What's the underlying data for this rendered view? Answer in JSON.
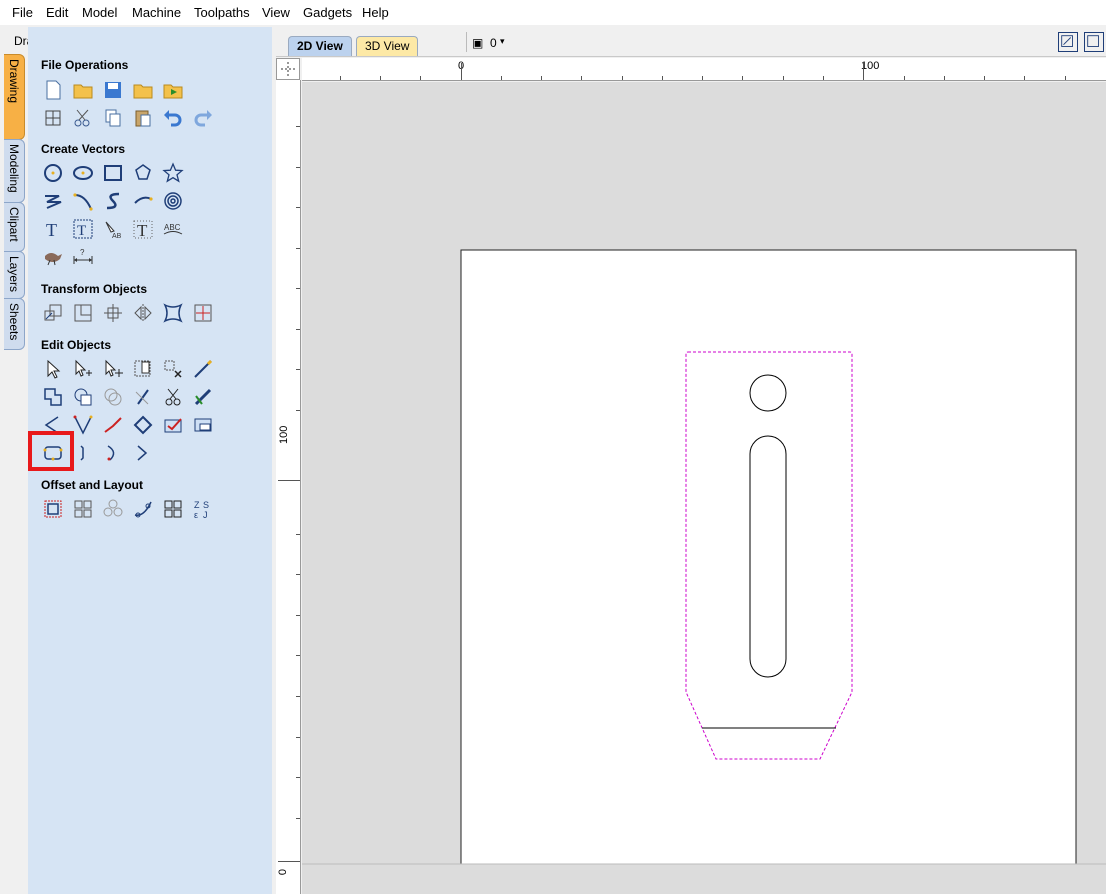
{
  "menu": [
    "File",
    "Edit",
    "Model",
    "Machine",
    "Toolpaths",
    "View",
    "Gadgets",
    "Help"
  ],
  "left_pane": {
    "title": "Drawing",
    "help": "?",
    "pin": "⊞",
    "vertical_tabs": [
      "Drawing",
      "Modeling",
      "Clipart",
      "Layers",
      "Sheets"
    ],
    "sections": {
      "file_operations": "File Operations",
      "create_vectors": "Create Vectors",
      "transform_objects": "Transform Objects",
      "edit_objects": "Edit Objects",
      "offset_layout": "Offset and Layout"
    }
  },
  "view_tabs": {
    "tab_2d": "2D View",
    "tab_3d": "3D View",
    "layer_count": "0"
  },
  "ruler": {
    "top_0": "0",
    "top_100": "100",
    "left_100": "100",
    "left_0": "0"
  },
  "colors": {
    "panel_bg": "#d6e4f4",
    "active_tab": "#f7b045",
    "highlight": "#e8191b",
    "offset_path": "#cc00cc"
  }
}
